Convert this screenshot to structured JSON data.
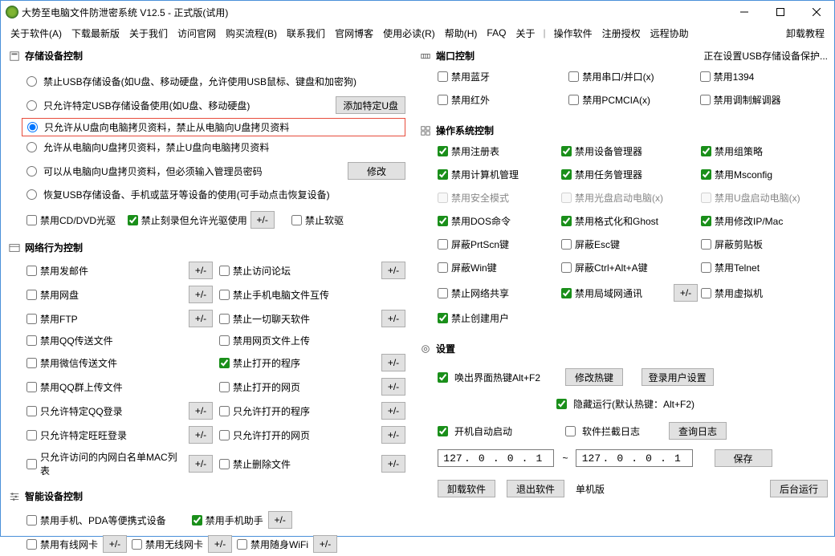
{
  "window": {
    "title": "大势至电脑文件防泄密系统 V12.5 - 正式版(试用)"
  },
  "menu": {
    "about_soft": "关于软件(A)",
    "download": "下载最新版",
    "about_us": "关于我们",
    "visit": "访问官网",
    "buy": "购买流程(B)",
    "contact": "联系我们",
    "blog": "官网博客",
    "must_read": "使用必读(R)",
    "help": "帮助(H)",
    "faq": "FAQ",
    "about": "关于",
    "operate": "操作软件",
    "reg_auth": "注册授权",
    "remote": "远程协助",
    "uninstall": "卸载教程"
  },
  "storage": {
    "title": "存储设备控制",
    "r1": "禁止USB存储设备(如U盘、移动硬盘，允许使用USB鼠标、键盘和加密狗)",
    "r2": "只允许特定USB存储设备使用(如U盘、移动硬盘)",
    "r2_btn": "添加特定U盘",
    "r3": "只允许从U盘向电脑拷贝资料，禁止从电脑向U盘拷贝资料",
    "r4": "允许从电脑向U盘拷贝资料，禁止U盘向电脑拷贝资料",
    "r5": "可以从电脑向U盘拷贝资料，但必须输入管理员密码",
    "r5_btn": "修改",
    "r6": "恢复USB存储设备、手机或蓝牙等设备的使用(可手动点击恢复设备)",
    "cd": "禁用CD/DVD光驱",
    "burn": "禁止刻录但允许光驱使用",
    "pm": "+/-",
    "floppy": "禁止软驱"
  },
  "net": {
    "title": "网络行为控制",
    "mail": "禁用发邮件",
    "forum": "禁止访问论坛",
    "disk": "禁用网盘",
    "phone_pc": "禁止手机电脑文件互传",
    "ftp": "禁用FTP",
    "chat": "禁止一切聊天软件",
    "qq_send": "禁用QQ传送文件",
    "web_upload": "禁用网页文件上传",
    "wechat_send": "禁用微信传送文件",
    "open_prog": "禁止打开的程序",
    "qq_group": "禁用QQ群上传文件",
    "open_web": "禁止打开的网页",
    "qq_login": "只允许特定QQ登录",
    "allow_prog": "只允许打开的程序",
    "ww_login": "只允许特定旺旺登录",
    "allow_web": "只允许打开的网页",
    "mac_list": "只允许访问的内网白名单MAC列表",
    "del_file": "禁止删除文件"
  },
  "smart": {
    "title": "智能设备控制",
    "pda": "禁用手机、PDA等便携式设备",
    "helper": "禁用手机助手",
    "wired": "禁用有线网卡",
    "wireless": "禁用无线网卡",
    "wifi": "禁用随身WiFi"
  },
  "port": {
    "title": "端口控制",
    "status": "正在设置USB存储设备保护...",
    "bt": "禁用蓝牙",
    "serial": "禁用串口/并口(x)",
    "p1394": "禁用1394",
    "ir": "禁用红外",
    "pcmcia": "禁用PCMCIA(x)",
    "modem": "禁用调制解调器"
  },
  "os": {
    "title": "操作系统控制",
    "reg": "禁用注册表",
    "devmgr": "禁用设备管理器",
    "gpo": "禁用组策略",
    "compmgr": "禁用计算机管理",
    "taskmgr": "禁用任务管理器",
    "msconfig": "禁用Msconfig",
    "safemode": "禁用安全模式",
    "cdboot": "禁用光盘启动电脑(x)",
    "uboot": "禁用U盘启动电脑(x)",
    "dos": "禁用DOS命令",
    "ghost": "禁用格式化和Ghost",
    "ipmac": "禁用修改IP/Mac",
    "prtscn": "屏蔽PrtScn键",
    "esc": "屏蔽Esc键",
    "clip": "屏蔽剪贴板",
    "win": "屏蔽Win键",
    "ctrlalta": "屏蔽Ctrl+Alt+A键",
    "telnet": "禁用Telnet",
    "netshare": "禁止网络共享",
    "lan": "禁用局域网通讯",
    "vm": "禁用虚拟机",
    "newuser": "禁止创建用户"
  },
  "settings": {
    "title": "设置",
    "hotkey": "唤出界面热键Alt+F2",
    "hotkey_btn": "修改热键",
    "user_btn": "登录用户设置",
    "hide": "隐藏运行(默认热键：Alt+F2)",
    "autostart": "开机自动启动",
    "blocklog": "软件拦截日志",
    "log_btn": "查询日志",
    "ip1": {
      "a": "127",
      "b": "0",
      "c": "0",
      "d": "1"
    },
    "ip_sep": "~",
    "ip2": {
      "a": "127",
      "b": "0",
      "c": "0",
      "d": "1"
    },
    "save": "保存"
  },
  "bottom": {
    "uninstall": "卸载软件",
    "exit": "退出软件",
    "single": "单机版",
    "bg": "后台运行"
  }
}
